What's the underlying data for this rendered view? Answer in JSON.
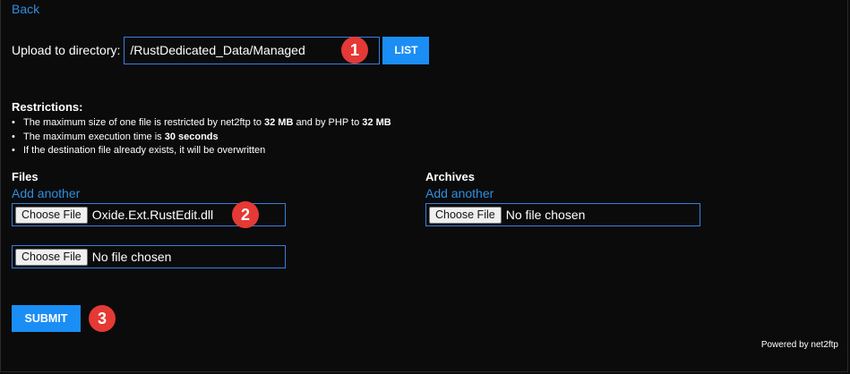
{
  "nav": {
    "back_label": "Back"
  },
  "upload": {
    "label": "Upload to directory:",
    "directory_value": "/RustDedicated_Data/Managed",
    "list_button": "LIST"
  },
  "restrictions": {
    "title": "Restrictions:",
    "item1": {
      "prefix": "The maximum size of one file is restricted by net2ftp to ",
      "net2ftp_limit": "32 MB",
      "middle": " and by PHP to ",
      "php_limit": "32 MB"
    },
    "item2": {
      "prefix": "The maximum execution time is ",
      "time": "30 seconds"
    },
    "item3": {
      "text": "If the destination file already exists, it will be overwritten"
    }
  },
  "files": {
    "title": "Files",
    "add_another": "Add another",
    "inputs": [
      {
        "button": "Choose File",
        "filename": "Oxide.Ext.RustEdit.dll"
      },
      {
        "button": "Choose File",
        "filename": "No file chosen"
      }
    ]
  },
  "archives": {
    "title": "Archives",
    "add_another": "Add another",
    "inputs": [
      {
        "button": "Choose File",
        "filename": "No file chosen"
      }
    ]
  },
  "submit_label": "SUBMIT",
  "footer": {
    "powered_by": "Powered by net2ftp"
  },
  "annotations": {
    "badge1": "1",
    "badge2": "2",
    "badge3": "3"
  },
  "colors": {
    "background": "#0b0b0b",
    "link": "#2f8fe0",
    "button": "#1a8ef5",
    "input_border": "#3b7fd8",
    "badge": "#e53935"
  }
}
